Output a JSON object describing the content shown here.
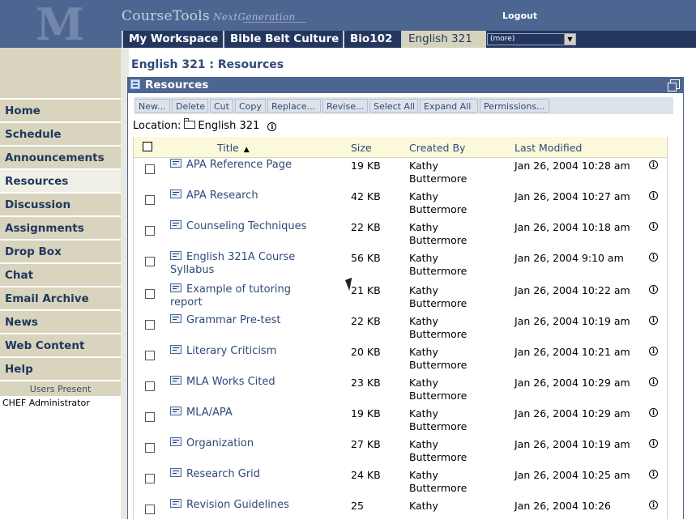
{
  "header": {
    "brand": "CourseTools",
    "brand_suffix": "NextGeneration",
    "logout_label": "Logout",
    "tabs": [
      "My Workspace",
      "Bible Belt Culture",
      "Bio102",
      "English 321"
    ],
    "active_tab": "English 321",
    "more_select": "(more)"
  },
  "sidebar": {
    "items": [
      "Home",
      "Schedule",
      "Announcements",
      "Resources",
      "Discussion",
      "Assignments",
      "Drop Box",
      "Chat",
      "Email Archive",
      "News",
      "Web Content",
      "Help"
    ],
    "active_item": "Resources",
    "users_present_label": "Users Present",
    "users": [
      "CHEF Administrator"
    ]
  },
  "main": {
    "title": "English 321 :  Resources",
    "panel_title": "Resources",
    "toolbar": [
      "New...",
      "Delete",
      "Cut",
      "Copy",
      "Replace...",
      "Revise...",
      "Select All",
      "Expand All",
      "Permissions..."
    ],
    "location_label": "Location:",
    "location_value": "English 321"
  },
  "table": {
    "columns": {
      "title": "Title",
      "size": "Size",
      "created_by": "Created By",
      "last_modified": "Last Modified"
    },
    "rows": [
      {
        "title": "APA Reference Page",
        "size": "19 KB",
        "created_by": "Kathy Buttermore",
        "last_modified": "Jan 26, 2004 10:28 am"
      },
      {
        "title": "APA Research",
        "size": "42 KB",
        "created_by": "Kathy Buttermore",
        "last_modified": "Jan 26, 2004 10:27 am"
      },
      {
        "title": "Counseling Techniques",
        "size": "22 KB",
        "created_by": "Kathy Buttermore",
        "last_modified": "Jan 26, 2004 10:18 am"
      },
      {
        "title": "English 321A Course Syllabus",
        "size": "56 KB",
        "created_by": "Kathy Buttermore",
        "last_modified": "Jan 26, 2004 9:10 am"
      },
      {
        "title": "Example of tutoring report",
        "size": "21 KB",
        "created_by": "Kathy Buttermore",
        "last_modified": "Jan 26, 2004 10:22 am"
      },
      {
        "title": "Grammar Pre-test",
        "size": "22 KB",
        "created_by": "Kathy Buttermore",
        "last_modified": "Jan 26, 2004 10:19 am"
      },
      {
        "title": "Literary Criticism",
        "size": "20 KB",
        "created_by": "Kathy Buttermore",
        "last_modified": "Jan 26, 2004 10:21 am"
      },
      {
        "title": "MLA Works Cited",
        "size": "23 KB",
        "created_by": "Kathy Buttermore",
        "last_modified": "Jan 26, 2004 10:29 am"
      },
      {
        "title": "MLA/APA",
        "size": "19 KB",
        "created_by": "Kathy Buttermore",
        "last_modified": "Jan 26, 2004 10:29 am"
      },
      {
        "title": "Organization",
        "size": "27 KB",
        "created_by": "Kathy Buttermore",
        "last_modified": "Jan 26, 2004 10:19 am"
      },
      {
        "title": "Research Grid",
        "size": "24 KB",
        "created_by": "Kathy Buttermore",
        "last_modified": "Jan 26, 2004 10:25 am"
      },
      {
        "title": "Revision Guidelines",
        "size": "25",
        "created_by": "Kathy",
        "last_modified": "Jan 26, 2004 10:26"
      }
    ]
  }
}
